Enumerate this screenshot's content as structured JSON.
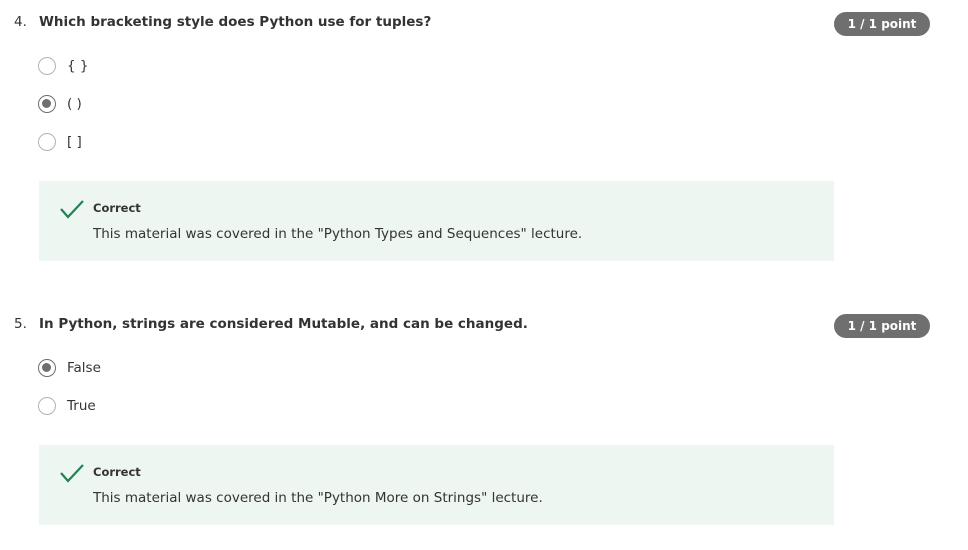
{
  "questions": [
    {
      "number": "4.",
      "text": "Which bracketing style does Python use for tuples?",
      "points": "1 / 1 point",
      "options": [
        {
          "label": "{ }",
          "selected": false
        },
        {
          "label": "( )",
          "selected": true
        },
        {
          "label": "[ ]",
          "selected": false
        }
      ],
      "feedback": {
        "status": "Correct",
        "message": "This material was covered in the \"Python Types and Sequences\" lecture.",
        "icon": "checkmark-icon",
        "color": "#1f8354"
      }
    },
    {
      "number": "5.",
      "text": "In Python, strings are considered Mutable, and can be changed.",
      "points": "1 / 1 point",
      "options": [
        {
          "label": "False",
          "selected": true
        },
        {
          "label": "True",
          "selected": false
        }
      ],
      "feedback": {
        "status": "Correct",
        "message": "This material was covered in the \"Python More on Strings\" lecture.",
        "icon": "checkmark-icon",
        "color": "#1f8354"
      }
    }
  ],
  "colors": {
    "badge_bg": "#6f6f6f",
    "feedback_bg": "#eef6f2",
    "correct_green": "#1f8354"
  }
}
